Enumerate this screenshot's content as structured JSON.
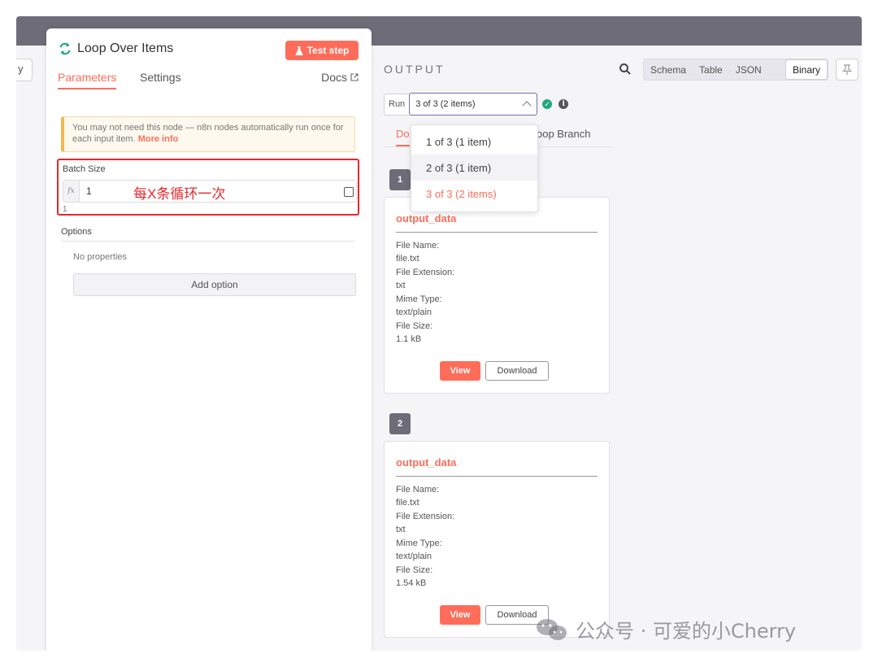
{
  "left_stub": {
    "text": "y"
  },
  "panel": {
    "title": "Loop Over Items",
    "test_step_label": "Test step",
    "tabs": [
      {
        "label": "Parameters"
      },
      {
        "label": "Settings"
      }
    ],
    "docs_label": "Docs",
    "notice_text": "You may not need this node — n8n nodes automatically run once for each input item.",
    "notice_link": "More info",
    "batch_size": {
      "label": "Batch Size",
      "value": "1",
      "hint": "1",
      "annotation": "每X条循环一次"
    },
    "options": {
      "label": "Options",
      "empty_text": "No properties",
      "add_label": "Add option"
    }
  },
  "output": {
    "title": "OUTPUT",
    "view_modes": [
      {
        "label": "Schema"
      },
      {
        "label": "Table"
      },
      {
        "label": "JSON"
      },
      {
        "label": "Binary"
      }
    ],
    "active_view": "Binary",
    "run": {
      "label": "Run",
      "selected": "3 of 3 (2 items)"
    },
    "branch_tabs": [
      {
        "label": "Do"
      },
      {
        "label": "oop Branch"
      }
    ],
    "dropdown_options": [
      {
        "label": "1 of 3 (1 item)"
      },
      {
        "label": "2 of 3 (1 item)"
      },
      {
        "label": "3 of 3 (2 items)"
      }
    ],
    "items": [
      {
        "index": "1",
        "title": "output_data",
        "file_name_key": "File Name:",
        "file_name": "file.txt",
        "ext_key": "File Extension:",
        "ext": "txt",
        "mime_key": "Mime Type:",
        "mime": "text/plain",
        "size_key": "File Size:",
        "size": "1.1 kB",
        "view_label": "View",
        "download_label": "Download"
      },
      {
        "index": "2",
        "title": "output_data",
        "file_name_key": "File Name:",
        "file_name": "file.txt",
        "ext_key": "File Extension:",
        "ext": "txt",
        "mime_key": "Mime Type:",
        "mime": "text/plain",
        "size_key": "File Size:",
        "size": "1.54 kB",
        "view_label": "View",
        "download_label": "Download"
      }
    ]
  },
  "watermark": "公众号 · 可爱的小Cherry",
  "colors": {
    "accent": "#ff6d5a",
    "annotation": "#e8282b",
    "topbar": "#6e6c78",
    "success": "#1ea97c"
  }
}
